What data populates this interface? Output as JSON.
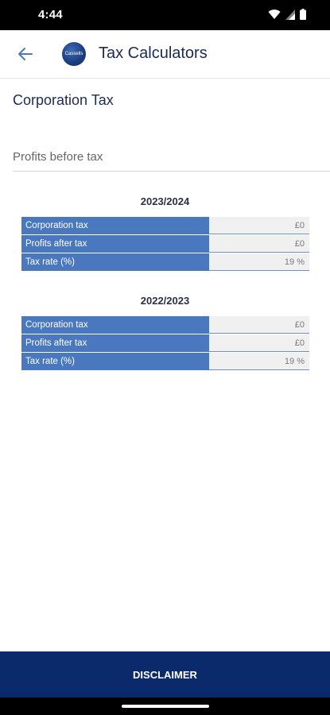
{
  "status_bar": {
    "time": "4:44"
  },
  "app_bar": {
    "title": "Tax Calculators",
    "logo_text": "Cassells"
  },
  "section_title": "Corporation Tax",
  "profits_input": {
    "placeholder": "Profits before tax",
    "value": ""
  },
  "tables": [
    {
      "year": "2023/2024",
      "rows": [
        {
          "label": "Corporation tax",
          "value": "£0"
        },
        {
          "label": "Profits after tax",
          "value": "£0"
        },
        {
          "label": "Tax rate (%)",
          "value": "19 %"
        }
      ]
    },
    {
      "year": "2022/2023",
      "rows": [
        {
          "label": "Corporation tax",
          "value": "£0"
        },
        {
          "label": "Profits after tax",
          "value": "£0"
        },
        {
          "label": "Tax rate (%)",
          "value": "19 %"
        }
      ]
    }
  ],
  "footer": {
    "disclaimer_label": "DISCLAIMER"
  },
  "icons": {
    "back": "arrow-left-icon",
    "wifi": "wifi-icon",
    "signal": "signal-icon",
    "battery": "battery-icon"
  },
  "colors": {
    "header_row": "#4978bf",
    "footer": "#0a2a6b",
    "title": "#1c2a55"
  }
}
